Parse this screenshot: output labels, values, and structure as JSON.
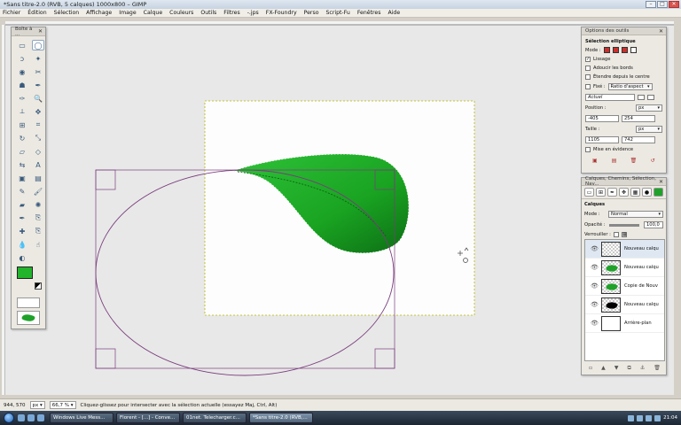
{
  "window": {
    "title": "*Sans titre-2.0 (RVB, 5 calques) 1000x800 – GIMP",
    "min": "–",
    "max": "□",
    "close": "✕"
  },
  "menu": [
    "Fichier",
    "Édition",
    "Sélection",
    "Affichage",
    "Image",
    "Calque",
    "Couleurs",
    "Outils",
    "Filtres",
    "-.jps",
    "FX-Foundry",
    "Perso",
    "Script-Fu",
    "Fenêtres",
    "Aide"
  ],
  "toolbox": {
    "title": "Boîte à ...",
    "close": "✕",
    "tools": [
      "rect-select-icon",
      "ellipse-select-icon",
      "lasso-icon",
      "fuzzy-select-icon",
      "color-select-icon",
      "scissors-icon",
      "foreground-select-icon",
      "paths-icon",
      "color-picker-icon",
      "zoom-icon",
      "measure-icon",
      "move-icon",
      "align-icon",
      "crop-icon",
      "rotate-icon",
      "scale-icon",
      "shear-icon",
      "perspective-icon",
      "flip-icon",
      "text-icon",
      "bucket-fill-icon",
      "blend-icon",
      "pencil-icon",
      "paintbrush-icon",
      "eraser-icon",
      "airbrush-icon",
      "ink-icon",
      "clone-icon",
      "heal-icon",
      "perspective-clone-icon",
      "blur-icon",
      "smudge-icon",
      "dodge-icon"
    ],
    "glyphs": [
      "▭",
      "◯",
      "ↄ",
      "✦",
      "◉",
      "✂",
      "☗",
      "✒",
      "✑",
      "🔍",
      "⟂",
      "✥",
      "⊞",
      "⌗",
      "↻",
      "⤡",
      "▱",
      "◇",
      "⇆",
      "A",
      "▣",
      "▤",
      "✎",
      "🖌",
      "▰",
      "✺",
      "✒",
      "⎘",
      "✚",
      "⎘",
      "💧",
      "☝",
      "◐"
    ],
    "fg_color": "#22b42b",
    "bg_color": "#1a8f22"
  },
  "tool_options": {
    "title": "Options des outils",
    "tool_name": "Sélection elliptique",
    "mode_label": "Mode :",
    "lissage": "Lissage",
    "adoucir": "Adoucir les bords",
    "etendre": "Étendre depuis le centre",
    "fixe": "Fixé :",
    "ratio": "Ratio d'aspect",
    "actuel": "Actuel",
    "position_label": "Position :",
    "pos_x": "-405",
    "pos_y": "254",
    "taille_label": "Taille :",
    "size_w": "1105",
    "size_h": "742",
    "unit": "px",
    "mise_en_evidence": "Mise en évidence"
  },
  "layers": {
    "title": "Calques, Chemins, Sélection, Nav...",
    "section": "Calques",
    "mode_label": "Mode :",
    "mode_value": "Normal",
    "opacity_label": "Opacité :",
    "opacity_value": "100,0",
    "lock_label": "Verrouiller :",
    "items": [
      {
        "name": "Nouveau calqu"
      },
      {
        "name": "Nouveau calqu"
      },
      {
        "name": "Copie de Nouv"
      },
      {
        "name": "Nouveau calqu"
      },
      {
        "name": "Arrière-plan"
      }
    ]
  },
  "status": {
    "coords": "944, 570",
    "unit": "px",
    "zoom": "66,7 %",
    "message": "Cliquez-glissez pour intersecter avec la sélection actuelle (essayez Maj, Ctrl, Alt)"
  },
  "taskbar": {
    "tasks": [
      "Windows Live Mess...",
      "Florent - [...] - Conve...",
      "01net. Telecharger.c...",
      "*Sans titre-2.0 (RVB,..."
    ],
    "clock": "21:04"
  }
}
